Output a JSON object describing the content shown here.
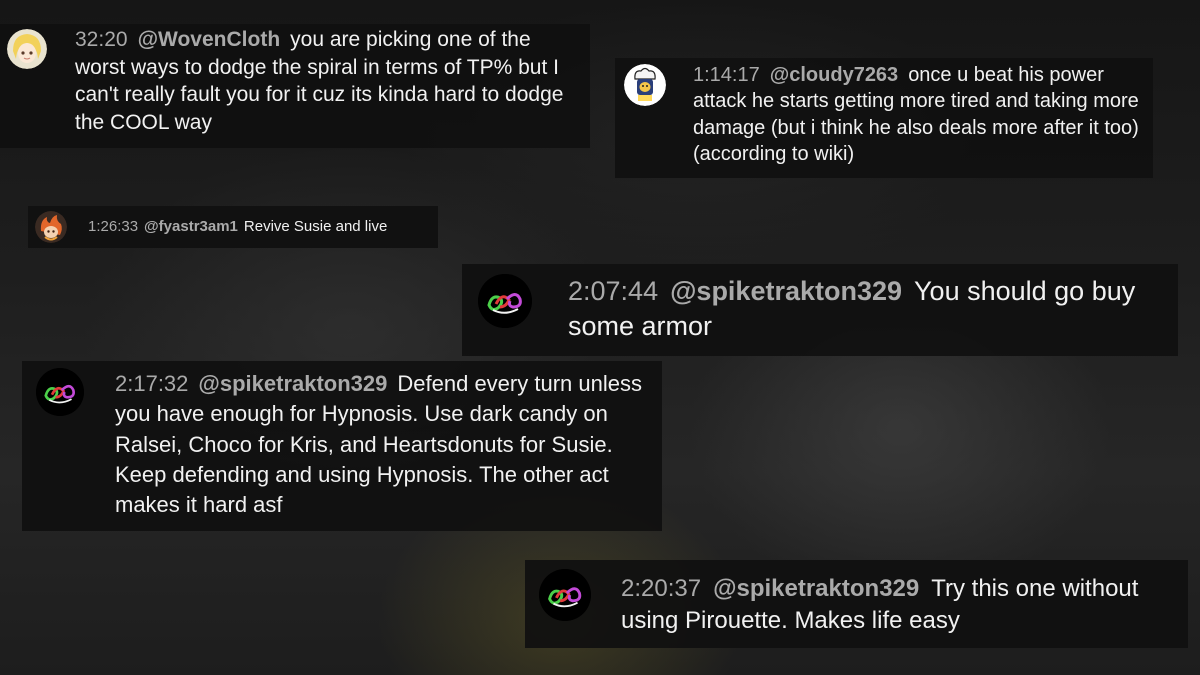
{
  "comments": [
    {
      "timestamp": "32:20",
      "author": "@WovenCloth",
      "text": "you are picking one of the worst ways to dodge the spiral in terms of TP% but I can't really fault you for it cuz its kinda hard to dodge the COOL way",
      "avatar": "anime-blonde-avatar-icon"
    },
    {
      "timestamp": "1:14:17",
      "author": "@cloudy7263",
      "text": "once u beat his power attack he starts getting more tired and taking more damage (but i think he also deals more after it too) (according to wiki)",
      "avatar": "chef-character-avatar-icon"
    },
    {
      "timestamp": "1:26:33",
      "author": "@fyastr3am1",
      "text": "Revive Susie and live",
      "avatar": "fire-character-avatar-icon"
    },
    {
      "timestamp": "2:07:44",
      "author": "@spiketrakton329",
      "text": "You should go buy some armor",
      "avatar": "colorful-logo-avatar-icon"
    },
    {
      "timestamp": "2:17:32",
      "author": "@spiketrakton329",
      "text": "Defend every turn unless you have enough for Hypnosis. Use dark candy on Ralsei, Choco for Kris, and Heartsdonuts for Susie. Keep defending and using Hypnosis. The other act makes it hard asf",
      "avatar": "colorful-logo-avatar-icon"
    },
    {
      "timestamp": "2:20:37",
      "author": "@spiketrakton329",
      "text": "Try this one without using Pirouette. Makes life easy",
      "avatar": "colorful-logo-avatar-icon"
    }
  ]
}
